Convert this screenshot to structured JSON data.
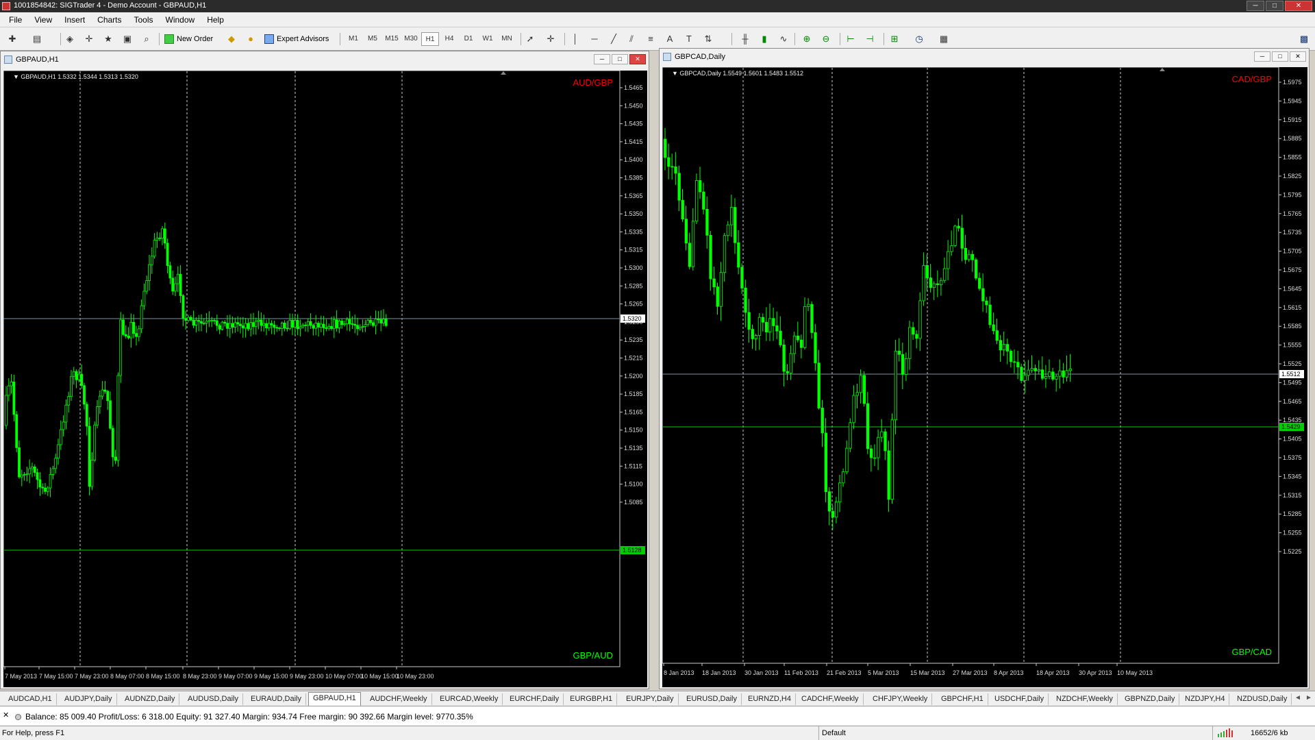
{
  "window": {
    "title": "1001854842: SIGTrader 4 - Demo Account - GBPAUD,H1",
    "minimize": "─",
    "maximize": "□",
    "close": "✕"
  },
  "menu": [
    "File",
    "View",
    "Insert",
    "Charts",
    "Tools",
    "Window",
    "Help"
  ],
  "toolbar": {
    "new_order": "New Order",
    "expert_advisors": "Expert Advisors",
    "timeframes": [
      "M1",
      "M5",
      "M15",
      "M30",
      "H1",
      "H4",
      "D1",
      "W1",
      "MN"
    ],
    "active_timeframe": "H1"
  },
  "charts": [
    {
      "window_title": "GBPAUD,H1",
      "info": "GBPAUD,H1  1.5332 1.5344 1.5313 1.5320",
      "top_label": "AUD/GBP",
      "bottom_label": "GBP/AUD",
      "bid": "1.5320",
      "hline": "1.5128",
      "prices": [
        "1.5465",
        "1.5450",
        "1.5435",
        "1.5415",
        "1.5400",
        "1.5385",
        "1.5365",
        "1.5350",
        "1.5335",
        "1.5315",
        "1.5300",
        "1.5285",
        "1.5265",
        "1.5250",
        "1.5235",
        "1.5215",
        "1.5200",
        "1.5185",
        "1.5165",
        "1.5150",
        "1.5135",
        "1.5115",
        "1.5100",
        "1.5085"
      ],
      "dates": [
        "7 May 2013",
        "7 May 15:00",
        "7 May 23:00",
        "8 May 07:00",
        "8 May 15:00",
        "8 May 23:00",
        "9 May 07:00",
        "9 May 15:00",
        "9 May 23:00",
        "10 May 07:00",
        "10 May 15:00",
        "10 May 23:00"
      ]
    },
    {
      "window_title": "GBPCAD,Daily",
      "info": "GBPCAD,Daily  1.5549 1.5601 1.5483 1.5512",
      "top_label": "CAD/GBP",
      "bottom_label": "GBP/CAD",
      "bid": "1.5512",
      "hline": "1.5429",
      "prices": [
        "1.5975",
        "1.5945",
        "1.5915",
        "1.5885",
        "1.5855",
        "1.5825",
        "1.5795",
        "1.5765",
        "1.5735",
        "1.5705",
        "1.5675",
        "1.5645",
        "1.5615",
        "1.5585",
        "1.5555",
        "1.5525",
        "1.5495",
        "1.5465",
        "1.5435",
        "1.5405",
        "1.5375",
        "1.5345",
        "1.5315",
        "1.5285",
        "1.5255",
        "1.5225"
      ],
      "dates": [
        "8 Jan 2013",
        "18 Jan 2013",
        "30 Jan 2013",
        "11 Feb 2013",
        "21 Feb 2013",
        "5 Mar 2013",
        "15 Mar 2013",
        "27 Mar 2013",
        "8 Apr 2013",
        "18 Apr 2013",
        "30 Apr 2013",
        "10 May 2013"
      ]
    }
  ],
  "tabs": [
    "AUDCAD,H1",
    "AUDJPY,Daily",
    "AUDNZD,Daily",
    "AUDUSD,Daily",
    "EURAUD,Daily",
    "GBPAUD,H1",
    "AUDCHF,Weekly",
    "EURCAD,Weekly",
    "EURCHF,Daily",
    "EURGBP,H1",
    "EURJPY,Daily",
    "EURUSD,Daily",
    "EURNZD,H4",
    "CADCHF,Weekly",
    "CHFJPY,Weekly",
    "GBPCHF,H1",
    "USDCHF,Daily",
    "NZDCHF,Weekly",
    "GBPNZD,Daily",
    "NZDJPY,H4",
    "NZDUSD,Daily"
  ],
  "active_tab": "GBPAUD,H1",
  "tab_nav": {
    "prev": "◄",
    "next": "►"
  },
  "account": {
    "close": "✕",
    "text": "Balance: 85 009.40  Profit/Loss: 6 318.00  Equity: 91 327.40  Margin: 934.74  Free margin: 90 392.66  Margin level: 9770.35%"
  },
  "status": {
    "help": "For Help, press F1",
    "profile": "Default",
    "traffic": "16652/6 kb"
  },
  "colors": {
    "candle": "#00ff00",
    "background": "#000000",
    "grid": "#ffffff",
    "label_red": "#ff0000",
    "label_green": "#00ff00"
  }
}
